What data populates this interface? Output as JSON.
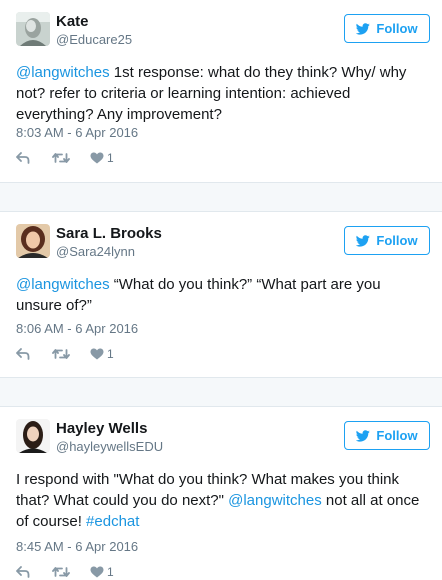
{
  "follow_label": "Follow",
  "icons": {
    "follow": "twitter-bird-icon",
    "reply": "reply-icon",
    "retweet": "retweet-icon",
    "like": "heart-icon"
  },
  "colors": {
    "link": "#1b95e0",
    "accent": "#1da1f2",
    "muted": "#657786"
  },
  "tweets": [
    {
      "name": "Kate",
      "handle": "@Educare25",
      "text": [
        {
          "t": "@langwitches",
          "link": true
        },
        {
          "t": " 1st response: what do they think? Why/ why not? refer to criteria or learning intention: achieved everything? Any improvement?",
          "link": false
        }
      ],
      "timestamp": "8:03 AM - 6 Apr 2016",
      "likes": "1"
    },
    {
      "name": "Sara L. Brooks",
      "handle": "@Sara24lynn",
      "text": [
        {
          "t": "@langwitches",
          "link": true
        },
        {
          "t": " “What do you think?” “What part are you unsure of?”",
          "link": false
        }
      ],
      "timestamp": "8:06 AM - 6 Apr 2016",
      "likes": "1"
    },
    {
      "name": "Hayley Wells",
      "handle": "@hayleywellsEDU",
      "text": [
        {
          "t": "I respond with \"What do you think? What makes you think that? What could you do next?\" ",
          "link": false
        },
        {
          "t": "@langwitches",
          "link": true
        },
        {
          "t": " not all at once of course! ",
          "link": false
        },
        {
          "t": "#edchat",
          "link": true
        }
      ],
      "timestamp": "8:45 AM - 6 Apr 2016",
      "likes": "1"
    }
  ]
}
